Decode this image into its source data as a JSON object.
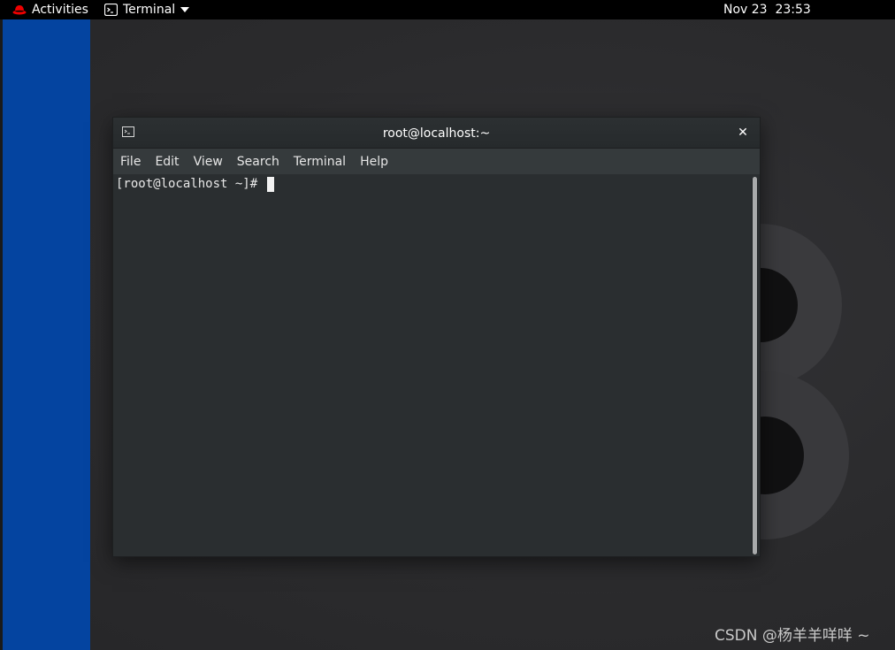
{
  "topbar": {
    "activities_label": "Activities",
    "app_menu_label": "Terminal",
    "clock": "Nov 23  23:53"
  },
  "window": {
    "title": "root@localhost:~",
    "close_glyph": "✕",
    "menus": [
      "File",
      "Edit",
      "View",
      "Search",
      "Terminal",
      "Help"
    ],
    "prompt": "[root@localhost ~]# "
  },
  "watermark": "CSDN @杨羊羊咩咩 ~",
  "icons": {
    "logo": "redhat-logo-icon",
    "app": "terminal-icon",
    "dropdown": "triangle-down-icon",
    "window": "terminal-icon",
    "close": "close-icon"
  },
  "colors": {
    "topbar_bg": "#000000",
    "panel_blue": "#0444a0",
    "redhat_red": "#ee0000",
    "terminal_bg": "#2a2e30",
    "text": "#ffffff"
  }
}
